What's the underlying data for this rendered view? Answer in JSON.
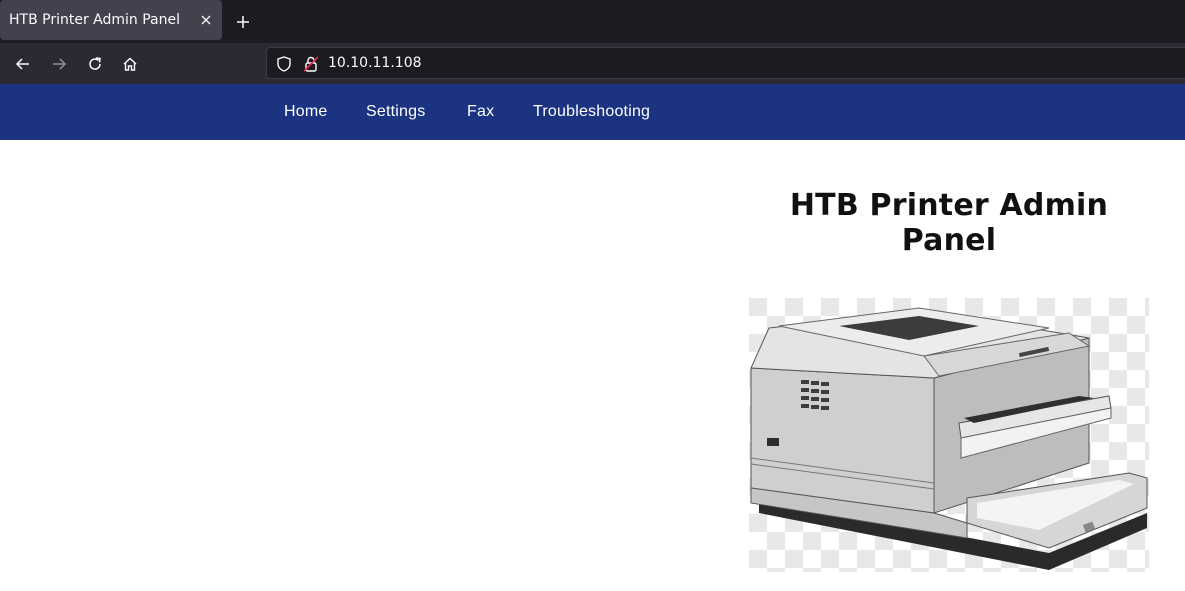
{
  "browser": {
    "tab_title": "HTB Printer Admin Panel",
    "url": "10.10.11.108",
    "icons": [
      "close-icon",
      "plus-icon",
      "back-arrow-icon",
      "forward-arrow-icon",
      "reload-icon",
      "home-icon",
      "shield-icon",
      "lock-icon"
    ]
  },
  "site": {
    "nav": {
      "items": [
        {
          "label": "Home"
        },
        {
          "label": "Settings"
        },
        {
          "label": "Fax"
        },
        {
          "label": "Troubleshooting"
        }
      ]
    },
    "title": "HTB Printer Admin Panel",
    "image": "printer-image"
  },
  "colors": {
    "nav_bg": "#1b3380",
    "tabbar_bg": "#1c1b22",
    "toolbar_bg": "#2b2a33"
  }
}
